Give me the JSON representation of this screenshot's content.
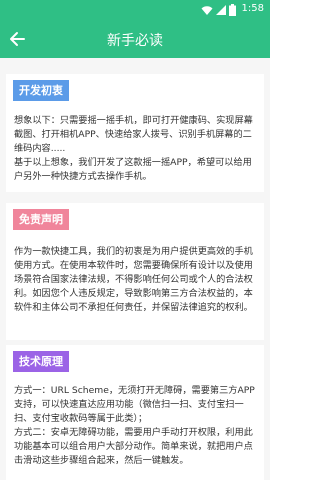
{
  "status_bar": {
    "time": "1:58",
    "icons": [
      "wifi-icon",
      "signal-icon",
      "battery-icon"
    ]
  },
  "app_bar": {
    "title": "新手必读",
    "back_icon": "arrow-left-icon"
  },
  "colors": {
    "primary": "#2fbf85",
    "tag_intent": "#5b9be8",
    "tag_disclaimer": "#f0859b",
    "tag_tech": "#9b63e6"
  },
  "sections": [
    {
      "tag": "开发初衷",
      "paragraphs": [
        "想象以下：只需要摇一摇手机，即可打开健康码、实现屏幕截图、打开相机APP、快速给家人拨号、识别手机屏幕的二维码内容.....",
        "基于以上想象，我们开发了这款摇一摇APP，希望可以给用户另外一种快捷方式去操作手机。"
      ]
    },
    {
      "tag": "免责声明",
      "paragraphs": [
        "作为一款快捷工具，我们的初衷是为用户提供更高效的手机使用方式。在使用本软件时，您需要确保所有设计以及使用场景符合国家法律法规，不得影响任何公司或个人的合法权利。如因您个人违反规定，导致影响第三方合法权益的，本软件和主体公司不承担任何责任，并保留法律追究的权利。"
      ]
    },
    {
      "tag": "技术原理",
      "paragraphs": [
        "方式一：URL Scheme，无须打开无障碍，需要第三方APP支持，可以快速直达应用功能（微信扫一扫、支付宝扫一扫、支付宝收款码等属于此类）；",
        "方式二：安卓无障碍功能，需要用户手动打开权限，利用此功能基本可以组合用户大部分动作。简单来说，就把用户点击滑动这些步骤组合起来，然后一键触发。"
      ]
    }
  ]
}
